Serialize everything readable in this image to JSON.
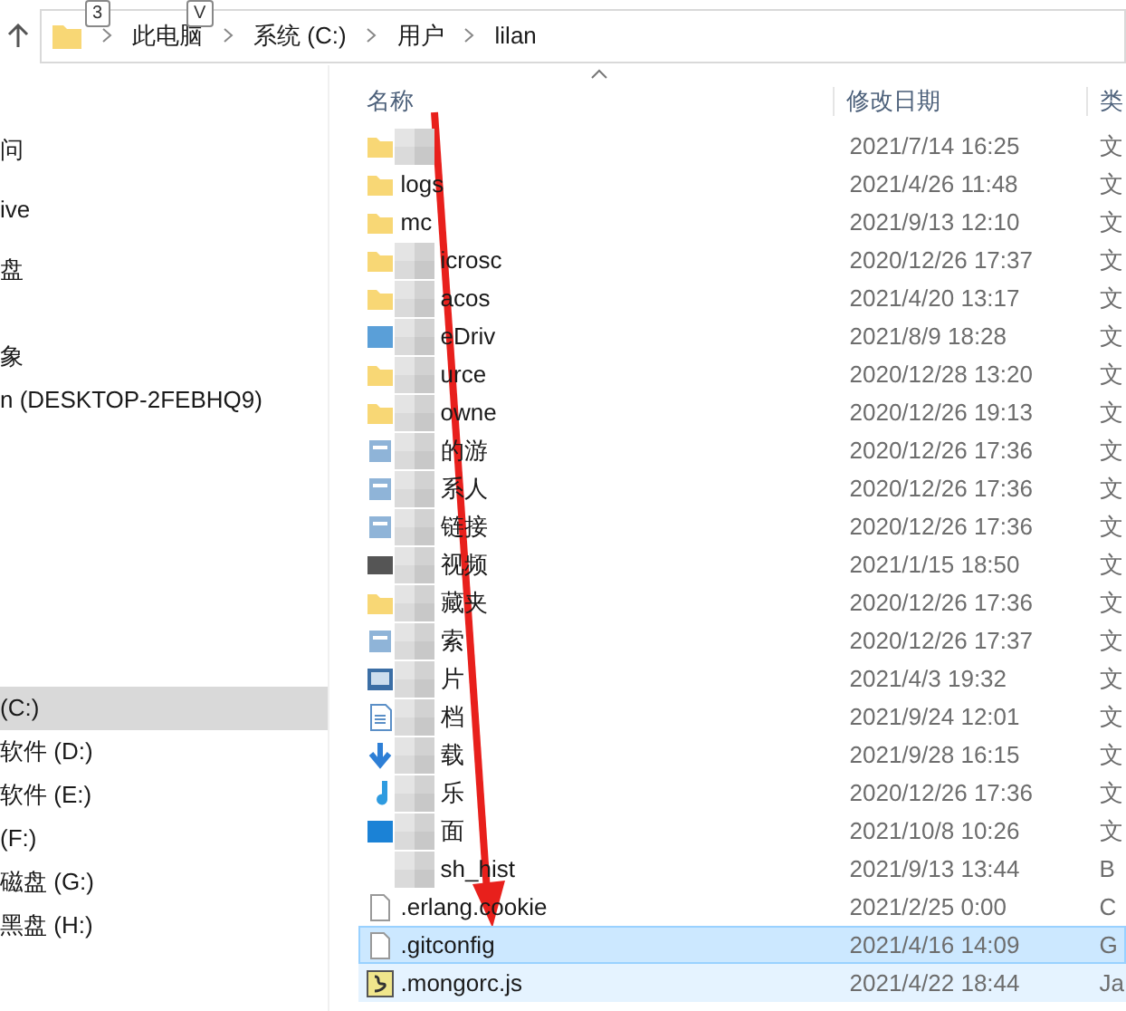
{
  "key_tips": [
    "3",
    "V"
  ],
  "address_bar": {
    "crumbs": [
      "此电脑",
      "系统 (C:)",
      "用户",
      "lilan"
    ]
  },
  "sidebar": {
    "sections": [
      {
        "items": [
          {
            "label": "问",
            "selected": false
          },
          {
            "label": "ive",
            "selected": false
          },
          {
            "label": "盘",
            "selected": false
          }
        ]
      },
      {
        "items": [
          {
            "label": "象",
            "selected": false
          },
          {
            "label": "n (DESKTOP-2FEBHQ9)",
            "selected": false
          }
        ]
      },
      {
        "items": [
          {
            "label": "(C:)",
            "selected": true
          },
          {
            "label": "软件 (D:)",
            "selected": false
          },
          {
            "label": "软件 (E:)",
            "selected": false
          },
          {
            "label": "(F:)",
            "selected": false
          },
          {
            "label": "磁盘 (G:)",
            "selected": false
          },
          {
            "label": "黑盘 (H:)",
            "selected": false
          }
        ]
      }
    ]
  },
  "file_list": {
    "columns": [
      "名称",
      "修改日期",
      "类"
    ],
    "rows": [
      {
        "kind": "folder",
        "blurred": true,
        "date": "2021/7/14 16:25",
        "type": "文",
        "selected": false,
        "hover": false
      },
      {
        "kind": "folder",
        "blurred": false,
        "name": "logs",
        "date": "2021/4/26 11:48",
        "type": "文",
        "selected": false,
        "hover": false
      },
      {
        "kind": "folder",
        "blurred": false,
        "name": "mc",
        "date": "2021/9/13 12:10",
        "type": "文",
        "selected": false,
        "hover": false
      },
      {
        "kind": "folder",
        "blurred": true,
        "name": "icrosc",
        "date": "2020/12/26 17:37",
        "type": "文",
        "selected": false,
        "hover": false
      },
      {
        "kind": "folder",
        "blurred": true,
        "name": "acos",
        "date": "2021/4/20 13:17",
        "type": "文",
        "selected": false,
        "hover": false
      },
      {
        "kind": "cloud",
        "blurred": true,
        "name": "eDriv",
        "date": "2021/8/9 18:28",
        "type": "文",
        "selected": false,
        "hover": false
      },
      {
        "kind": "folder",
        "blurred": true,
        "name": "urce",
        "date": "2020/12/28 13:20",
        "type": "文",
        "selected": false,
        "hover": false
      },
      {
        "kind": "folder",
        "blurred": true,
        "name": "owne",
        "date": "2020/12/26 19:13",
        "type": "文",
        "selected": false,
        "hover": false
      },
      {
        "kind": "special",
        "blurred": true,
        "name": "的游",
        "date": "2020/12/26 17:36",
        "type": "文",
        "selected": false,
        "hover": false
      },
      {
        "kind": "special",
        "blurred": true,
        "name": "系人",
        "date": "2020/12/26 17:36",
        "type": "文",
        "selected": false,
        "hover": false
      },
      {
        "kind": "special",
        "blurred": true,
        "name": "链接",
        "date": "2020/12/26 17:36",
        "type": "文",
        "selected": false,
        "hover": false
      },
      {
        "kind": "video",
        "blurred": true,
        "name": "视频",
        "date": "2021/1/15 18:50",
        "type": "文",
        "selected": false,
        "hover": false
      },
      {
        "kind": "folder",
        "blurred": true,
        "name": "藏夹",
        "date": "2020/12/26 17:36",
        "type": "文",
        "selected": false,
        "hover": false
      },
      {
        "kind": "special",
        "blurred": true,
        "name": "索",
        "date": "2020/12/26 17:37",
        "type": "文",
        "selected": false,
        "hover": false
      },
      {
        "kind": "picture",
        "blurred": true,
        "name": "片",
        "date": "2021/4/3 19:32",
        "type": "文",
        "selected": false,
        "hover": false
      },
      {
        "kind": "document",
        "blurred": true,
        "name": "档",
        "date": "2021/9/24 12:01",
        "type": "文",
        "selected": false,
        "hover": false
      },
      {
        "kind": "download",
        "blurred": true,
        "name": "载",
        "date": "2021/9/28 16:15",
        "type": "文",
        "selected": false,
        "hover": false
      },
      {
        "kind": "music",
        "blurred": true,
        "name": "乐",
        "date": "2020/12/26 17:36",
        "type": "文",
        "selected": false,
        "hover": false
      },
      {
        "kind": "desktop",
        "blurred": true,
        "name": "面",
        "date": "2021/10/8 10:26",
        "type": "文",
        "selected": false,
        "hover": false
      },
      {
        "kind": "blank",
        "blurred": true,
        "name": "sh_hist",
        "date": "2021/9/13 13:44",
        "type": "B",
        "selected": false,
        "hover": false
      },
      {
        "kind": "file",
        "blurred": false,
        "name": ".erlang.cookie",
        "date": "2021/2/25 0:00",
        "type": "C",
        "selected": false,
        "hover": false
      },
      {
        "kind": "file",
        "blurred": false,
        "name": ".gitconfig",
        "date": "2021/4/16 14:09",
        "type": "G",
        "selected": true,
        "hover": false
      },
      {
        "kind": "script",
        "blurred": false,
        "name": ".mongorc.js",
        "date": "2021/4/22 18:44",
        "type": "Ja",
        "selected": false,
        "hover": true
      }
    ]
  }
}
